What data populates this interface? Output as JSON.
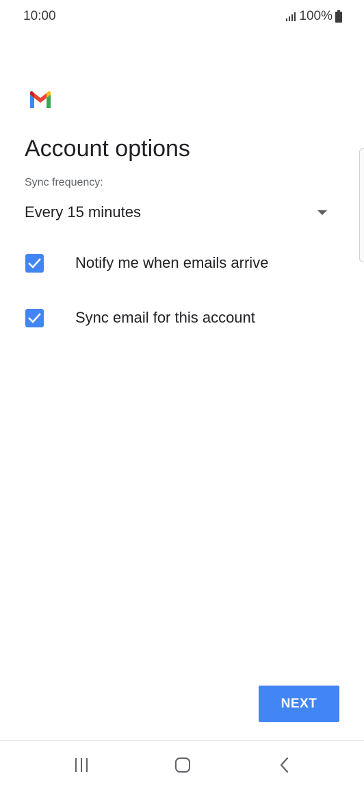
{
  "status_bar": {
    "time": "10:00",
    "battery": "100%",
    "icons": [
      "signal-icon",
      "battery-icon"
    ]
  },
  "app": {
    "logo_icon": "gmail-logo-icon"
  },
  "page": {
    "title": "Account options"
  },
  "sync": {
    "label": "Sync frequency:",
    "selected": "Every 15 minutes"
  },
  "options": [
    {
      "label": "Notify me when emails arrive",
      "checked": true
    },
    {
      "label": "Sync email for this account",
      "checked": true
    }
  ],
  "actions": {
    "next_label": "NEXT"
  },
  "nav": {
    "icons": [
      "recents-icon",
      "home-icon",
      "back-icon"
    ]
  },
  "colors": {
    "accent": "#4285f4",
    "text_primary": "#202124",
    "text_secondary": "#5f6368"
  }
}
